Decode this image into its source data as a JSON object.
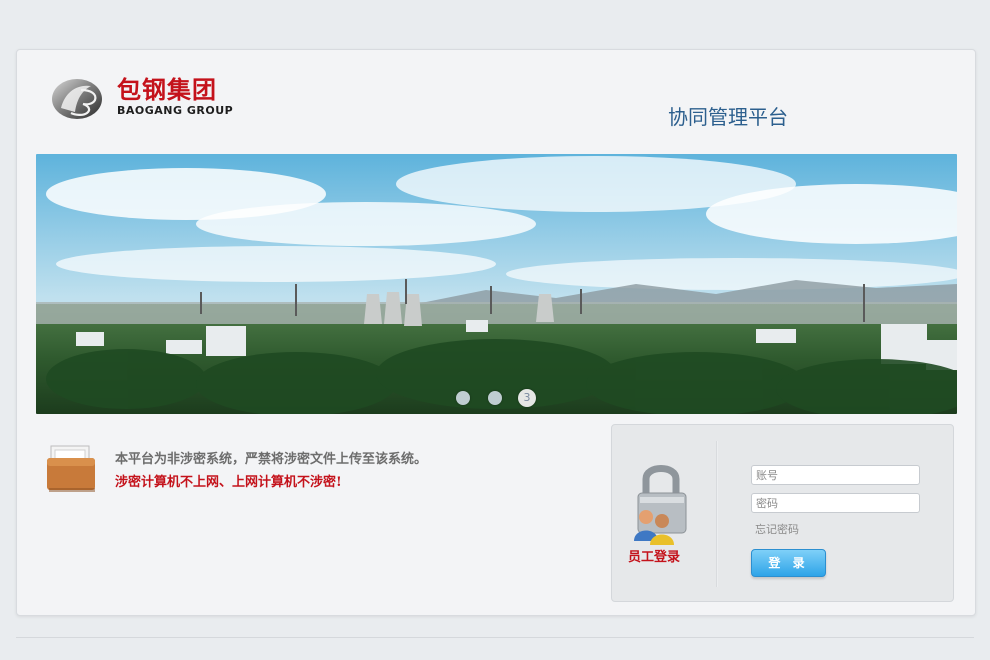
{
  "header": {
    "logo_cn": "包钢集团",
    "logo_en": "BAOGANG GROUP",
    "platform_title": "协同管理平台"
  },
  "banner": {
    "slides": [
      "1",
      "2",
      "3"
    ],
    "active_slide": "3"
  },
  "notice": {
    "line1": "本平台为非涉密系统，严禁将涉密文件上传至该系统。",
    "line2": "涉密计算机不上网、上网计算机不涉密!"
  },
  "login": {
    "staff_label": "员工登录",
    "username_placeholder": "账号",
    "password_placeholder": "密码",
    "forgot_label": "忘记密码",
    "login_label": "登 录"
  },
  "colors": {
    "brand_red": "#c4121b",
    "title_blue": "#2c5f8e",
    "button_blue": "#2ea4e8"
  },
  "icons": {
    "logo_mark": "baogang-logo-icon",
    "notice": "briefcase-icon",
    "login": "padlock-users-icon"
  }
}
